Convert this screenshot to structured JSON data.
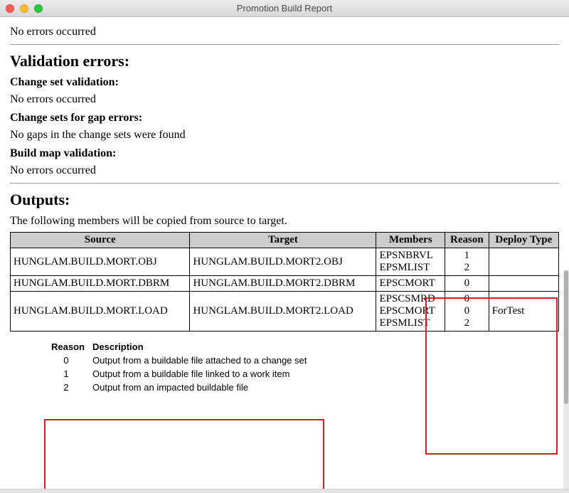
{
  "window": {
    "title": "Promotion Build Report"
  },
  "top_no_errors": "No errors occurred",
  "validation": {
    "heading": "Validation errors:",
    "changeset": {
      "label": "Change set validation:",
      "msg": "No errors occurred"
    },
    "gap": {
      "label": "Change sets for gap errors:",
      "msg": "No gaps in the change sets were found"
    },
    "buildmap": {
      "label": "Build map validation:",
      "msg": "No errors occurred"
    }
  },
  "outputs": {
    "heading": "Outputs:",
    "intro": "The following members will be copied from source to target.",
    "headers": [
      "Source",
      "Target",
      "Members",
      "Reason",
      "Deploy Type"
    ],
    "rows": [
      {
        "source": "HUNGLAM.BUILD.MORT.OBJ",
        "target": "HUNGLAM.BUILD.MORT2.OBJ",
        "members": [
          "EPSNBRVL",
          "EPSMLIST"
        ],
        "reasons": [
          "1",
          "2"
        ],
        "deploy": ""
      },
      {
        "source": "HUNGLAM.BUILD.MORT.DBRM",
        "target": "HUNGLAM.BUILD.MORT2.DBRM",
        "members": [
          "EPSCMORT"
        ],
        "reasons": [
          "0"
        ],
        "deploy": ""
      },
      {
        "source": "HUNGLAM.BUILD.MORT.LOAD",
        "target": "HUNGLAM.BUILD.MORT2.LOAD",
        "members": [
          "EPSCSMRD",
          "EPSCMORT",
          "EPSMLIST"
        ],
        "reasons": [
          "0",
          "0",
          "2"
        ],
        "deploy": "ForTest"
      }
    ]
  },
  "legend": {
    "headers": [
      "Reason",
      "Description"
    ],
    "rows": [
      {
        "code": "0",
        "desc": "Output from a buildable file attached to a change set"
      },
      {
        "code": "1",
        "desc": "Output from a buildable file linked to a work item"
      },
      {
        "code": "2",
        "desc": "Output from an impacted buildable file"
      }
    ]
  }
}
